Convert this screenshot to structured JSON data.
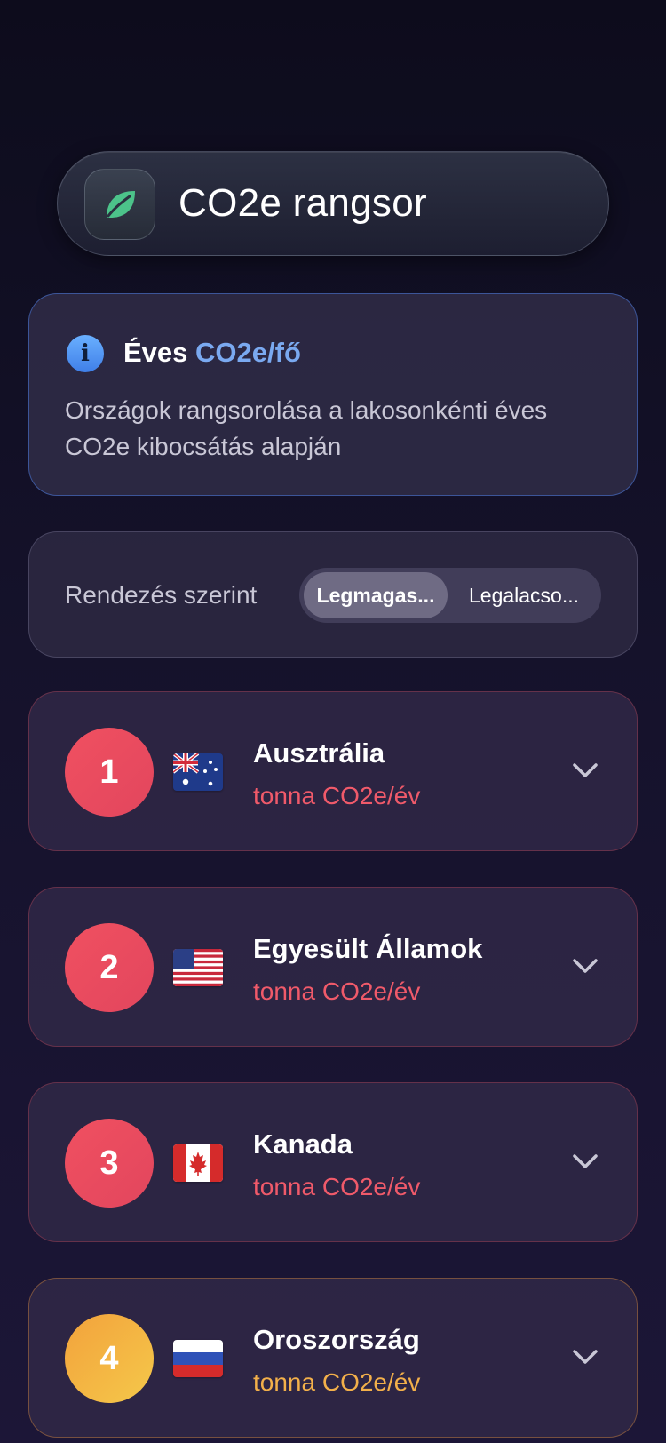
{
  "header": {
    "title": "CO2e rangsor",
    "icon": "leaf-icon",
    "icon_color": "#4cc38a"
  },
  "info": {
    "icon": "info-icon",
    "title_prefix": "Éves",
    "title_highlight": "CO2e/fő",
    "description": "Országok rangsorolása a lakosonkénti éves CO2e kibocsátás alapján"
  },
  "sort": {
    "label": "Rendezés szerint",
    "options": [
      "Legmagas...",
      "Legalacso..."
    ],
    "selected": "Legmagas..."
  },
  "rankings": [
    {
      "rank": "1",
      "country": "Ausztrália",
      "unit": "tonna CO2e/év",
      "flag": "australia-flag",
      "color": "#f05a6a"
    },
    {
      "rank": "2",
      "country": "Egyesült Államok",
      "unit": "tonna CO2e/év",
      "flag": "usa-flag",
      "color": "#f05a6a"
    },
    {
      "rank": "3",
      "country": "Kanada",
      "unit": "tonna CO2e/év",
      "flag": "canada-flag",
      "color": "#f05a6a"
    },
    {
      "rank": "4",
      "country": "Oroszország",
      "unit": "tonna CO2e/év",
      "flag": "russia-flag",
      "color": "#f3b04a"
    }
  ]
}
